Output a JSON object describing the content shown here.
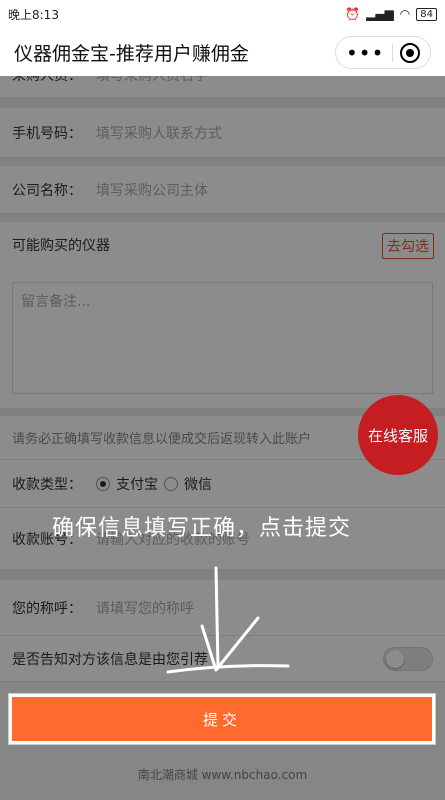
{
  "statusbar": {
    "time": "晚上8:13",
    "battery": "84"
  },
  "header": {
    "title": "仪器佣金宝-推荐用户赚佣金"
  },
  "form": {
    "contact_label": "采购人员：",
    "contact_placeholder": "填写采购人员名字",
    "phone_label": "手机号码：",
    "phone_placeholder": "填写采购人联系方式",
    "company_label": "公司名称：",
    "company_placeholder": "填写采购公司主体",
    "instrument_label": "可能购买的仪器",
    "instrument_button": "去勾选",
    "remark_placeholder": "留言备注...",
    "notice": "请务必正确填写收款信息以便成交后返现转入此账户",
    "pay_type_label": "收款类型：",
    "pay_options": [
      "支付宝",
      "微信"
    ],
    "pay_selected": "支付宝",
    "account_label": "收款账号：",
    "account_placeholder": "请输入对应的收款的账号",
    "nickname_label": "您的称呼：",
    "nickname_placeholder": "请填写您的称呼",
    "inform_label": "是否告知对方该信息是由您引荐",
    "submit_label": "提交"
  },
  "service_button": "在线客服",
  "footer": "南北潮商城 www.nbchao.com",
  "annotation": "确保信息填写正确，点击提交",
  "colors": {
    "accent": "#ff6b2c",
    "service": "#c8181d",
    "check_button": "#e4572e"
  }
}
